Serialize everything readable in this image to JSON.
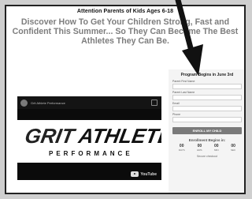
{
  "header": {
    "kicker": "Attention Parents of Kids Ages 6-18",
    "headline": "Discover How To Get Your Children Strong, Fast and Confident This Summer... So They Can Become The Best Athletes They Can Be."
  },
  "video": {
    "title": "Grit Athlete Performance",
    "logo_brand_1": "GRIT",
    "logo_brand_2": "ATHLETE",
    "logo_sub": "PERFORMANCE",
    "player_mark": "YouTube"
  },
  "form": {
    "title": "Program Begins in June 3rd",
    "fields": [
      {
        "label": "Parent First Name",
        "placeholder": ""
      },
      {
        "label": "Parent Last Name",
        "placeholder": ""
      },
      {
        "label": "Email",
        "placeholder": ""
      },
      {
        "label": "Phone",
        "placeholder": ""
      }
    ],
    "submit_label": "ENROLL MY CHILD",
    "enrollment_label": "Enrollment Begins in:",
    "countdown": [
      {
        "value": "00",
        "unit": "DAYS"
      },
      {
        "value": "00",
        "unit": "HRS"
      },
      {
        "value": "00",
        "unit": "MIN"
      },
      {
        "value": "00",
        "unit": "SEC"
      }
    ],
    "secure_note": "Secure checkout"
  },
  "colors": {
    "headline": "#7d7d7d",
    "background": "#cfcfcf",
    "page": "#ffffff",
    "arrow": "#111111"
  }
}
